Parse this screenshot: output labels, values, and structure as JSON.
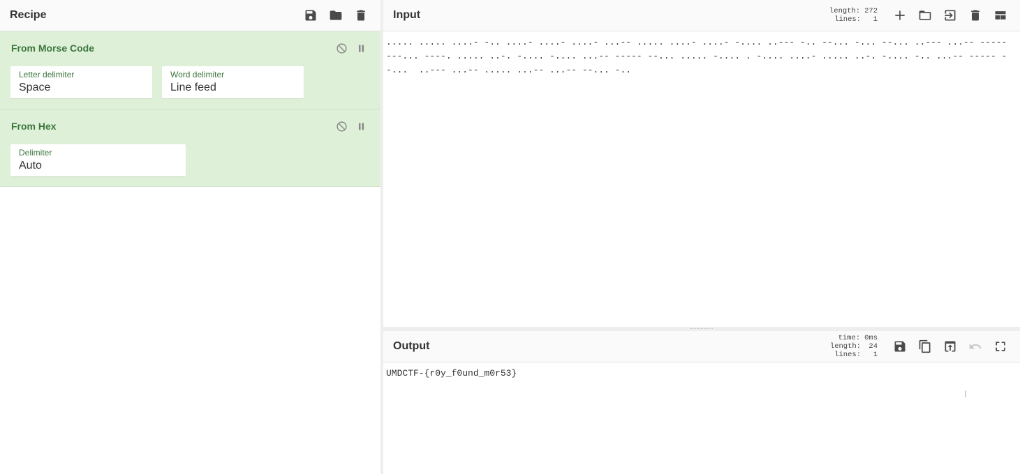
{
  "recipe": {
    "title": "Recipe",
    "operations": [
      {
        "name": "From Morse Code",
        "args": [
          {
            "label": "Letter delimiter",
            "value": "Space"
          },
          {
            "label": "Word delimiter",
            "value": "Line feed"
          }
        ]
      },
      {
        "name": "From Hex",
        "args": [
          {
            "label": "Delimiter",
            "value": "Auto"
          }
        ]
      }
    ]
  },
  "input": {
    "title": "Input",
    "length_label": "length:",
    "length_value": "272",
    "lines_label": "lines:",
    "lines_value": "1",
    "text": "..... ..... ....- -.. ....- ....- ....- ...-- ..... ....- ....- -.... ..--- -.. --... -... --... ..--- ...-- ----- ---... ----. ..... ..-. -.... -.... ...-- ----- --... ..... -.... . -.... ....- ..... ..-. -.... -.. ...-- ----- --...  ..--- ...-- ..... ...-- ...-- --... -.."
  },
  "output": {
    "title": "Output",
    "time_label": "time:",
    "time_value": "0ms",
    "length_label": "length:",
    "length_value": "24",
    "lines_label": "lines:",
    "lines_value": "1",
    "text": "UMDCTF-{r0y_f0und_m0r53}"
  },
  "icons": {
    "save": "save-icon",
    "open": "folder-icon",
    "clear": "trash-icon",
    "disable": "disable-icon",
    "breakpoint": "pause-icon",
    "add": "plus-icon",
    "open_folder": "folder-icon",
    "to_input": "arrow-into-icon",
    "layout": "layout-icon",
    "copy": "copy-icon",
    "replace": "upload-box-icon",
    "undo": "undo-icon",
    "maximize": "fullscreen-icon"
  },
  "colors": {
    "op_background": "#dff0d8",
    "op_title": "#3c763d"
  }
}
